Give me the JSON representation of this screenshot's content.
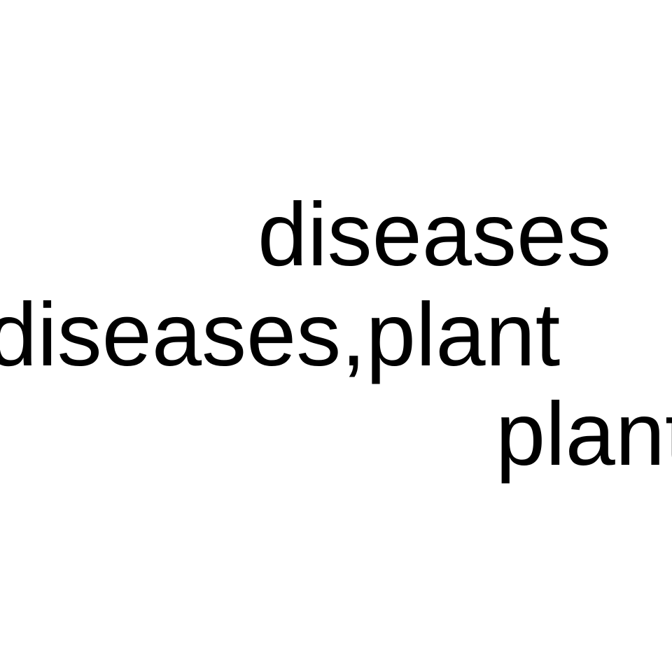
{
  "words": {
    "top": "diseases",
    "middle": "diseases,plant",
    "bottom": "plant"
  },
  "colors": {
    "background": "#ffffff",
    "text": "#000000"
  }
}
